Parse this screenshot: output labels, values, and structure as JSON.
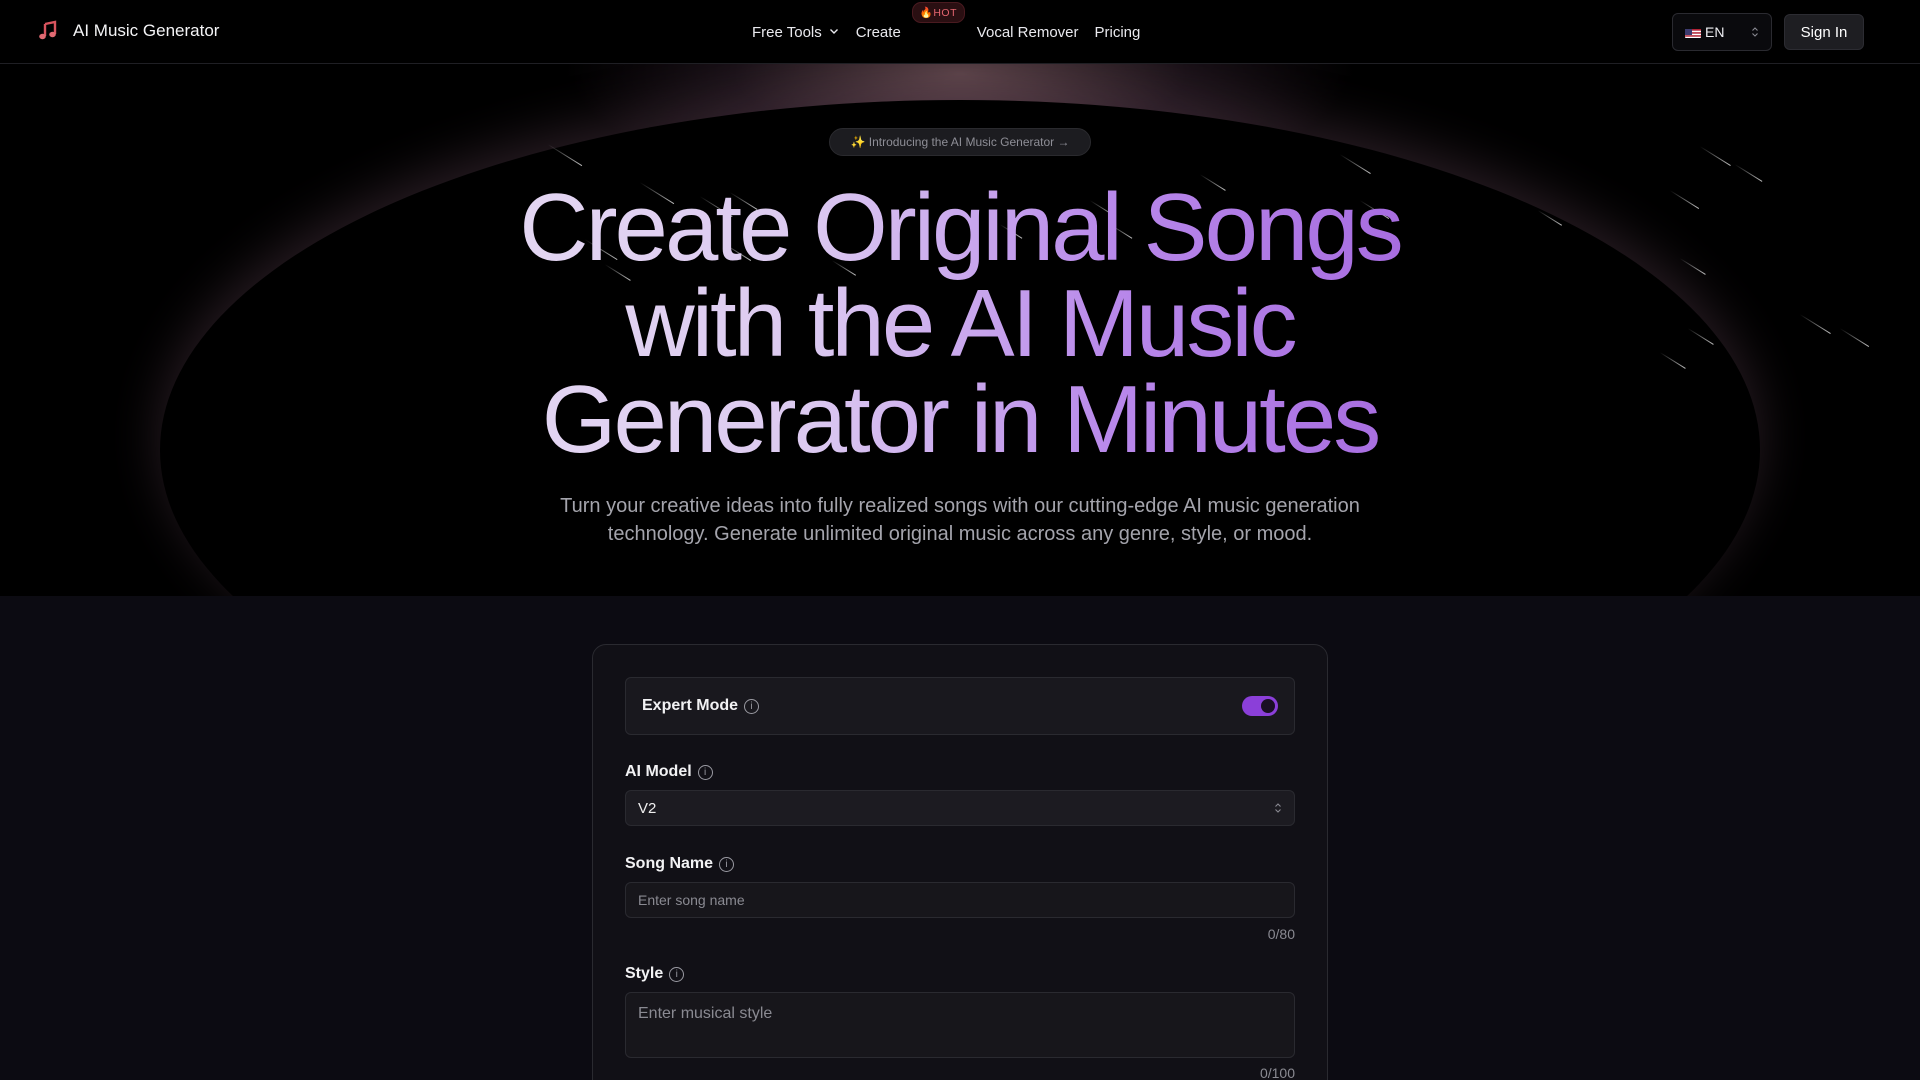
{
  "nav": {
    "brand": "AI Music Generator",
    "brand_icon": "music-note-icon",
    "links": {
      "free_tools": "Free Tools",
      "create": "Create",
      "hot_badge": "🔥HOT",
      "vocal_remover": "Vocal Remover",
      "pricing": "Pricing"
    },
    "language": "EN",
    "language_flag": "us-flag-icon",
    "sign_in": "Sign In"
  },
  "hero": {
    "intro_pill": "✨ Introducing the AI Music Generator →",
    "headline_lines": [
      "Create Original Songs",
      "with the AI Music",
      "Generator in Minutes"
    ],
    "subtext": "Turn your creative ideas into fully realized songs with our cutting-edge AI music generation technology. Generate unlimited original music across any genre, style, or mood."
  },
  "form": {
    "expert_mode": {
      "label": "Expert Mode",
      "enabled": true
    },
    "ai_model": {
      "label": "AI Model",
      "value": "V2"
    },
    "song_name": {
      "label": "Song Name",
      "placeholder": "Enter song name",
      "counter": "0/80"
    },
    "style": {
      "label": "Style",
      "placeholder": "Enter musical style",
      "counter": "0/100"
    }
  },
  "colors": {
    "accent": "#8b3fd9",
    "headline_gradient_start": "#f1ecf6",
    "headline_gradient_end": "#a569df",
    "hot_badge": "#e4656f"
  }
}
